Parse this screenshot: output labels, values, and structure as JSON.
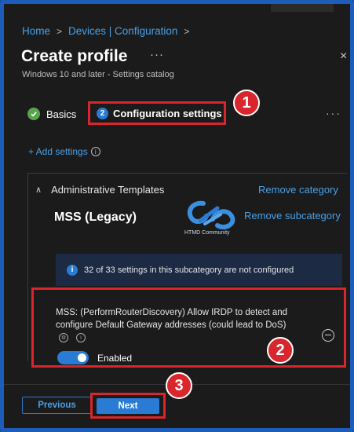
{
  "breadcrumb": {
    "home": "Home",
    "devices": "Devices | Configuration",
    "separator": ">"
  },
  "header": {
    "title": "Create profile",
    "more": "···",
    "close": "×",
    "subtitle": "Windows 10 and later - Settings catalog"
  },
  "steps": {
    "basics_label": "Basics",
    "config_number": "2",
    "config_label": "Configuration settings",
    "more": "···"
  },
  "add_settings": {
    "label": "+ Add settings",
    "info": "i"
  },
  "category": {
    "chevron": "∧",
    "name": "Administrative Templates",
    "remove_category": "Remove category",
    "subcategory": "MSS (Legacy)",
    "remove_subcategory": "Remove subcategory"
  },
  "logo": {
    "text": "HTMD Community"
  },
  "info_bar": {
    "icon": "i",
    "text": "32 of 33 settings in this subcategory are not configured"
  },
  "setting": {
    "description": "MSS: (PerformRouterDiscovery) Allow IRDP to detect and configure Default Gateway addresses (could lead to DoS)",
    "toggle_state": "Enabled",
    "toggle_on": true
  },
  "footer": {
    "previous": "Previous",
    "next": "Next"
  },
  "markers": [
    "1",
    "2",
    "3"
  ],
  "colors": {
    "accent": "#2a7bd4",
    "link": "#4aa0e6",
    "highlight": "#d8262c",
    "background": "#1b1b1b",
    "success": "#57a64a"
  }
}
